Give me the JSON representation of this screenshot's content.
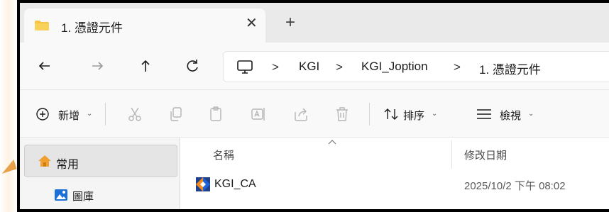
{
  "tab": {
    "title": "1. 憑證元件",
    "close_glyph": "✕",
    "new_tab_glyph": "+",
    "folder_icon": "folder-icon"
  },
  "nav": {
    "back_icon": "back-arrow-icon",
    "forward_icon": "forward-arrow-icon",
    "up_icon": "up-arrow-icon",
    "refresh_icon": "refresh-icon"
  },
  "address": {
    "root_icon": "this-pc-icon",
    "separator": ">",
    "crumbs": [
      "KGI",
      "KGI_Joption",
      "1. 憑證元件"
    ]
  },
  "toolbar": {
    "new_label": "新增",
    "sort_label": "排序",
    "view_label": "檢視",
    "chevron": "⌄"
  },
  "sidebar": {
    "home_label": "常用",
    "gallery_label": "圖庫"
  },
  "columns": {
    "name": "名稱",
    "date_modified": "修改日期"
  },
  "files": [
    {
      "name": "KGI_CA",
      "modified": "2025/10/2 下午 08:02",
      "icon": "app-shortcut-icon"
    }
  ],
  "colors": {
    "accent_orange": "#e8a04a",
    "folder_yellow": "#f4c542",
    "window_border": "#000000"
  }
}
